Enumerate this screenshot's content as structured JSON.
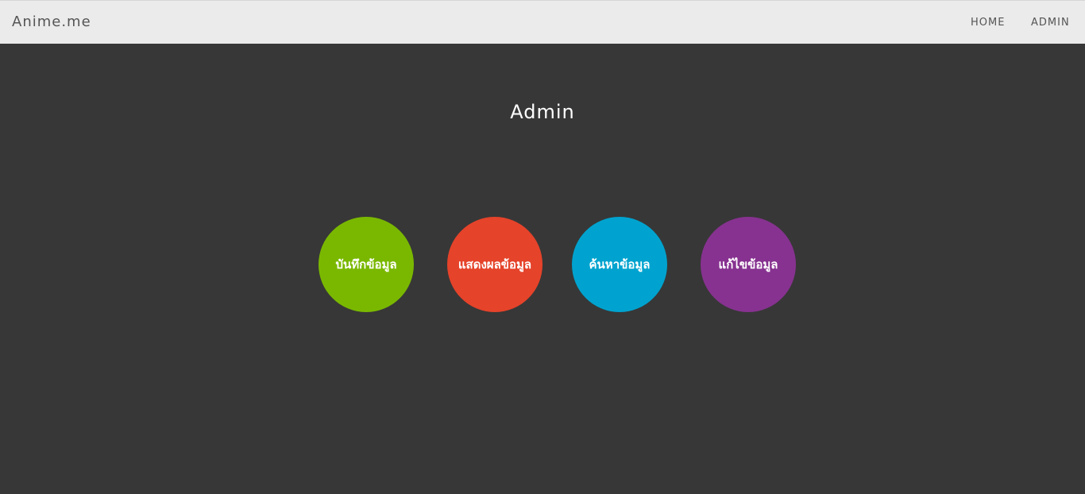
{
  "navbar": {
    "brand": "Anime.me",
    "links": [
      {
        "label": "HOME"
      },
      {
        "label": "ADMIN"
      }
    ]
  },
  "main": {
    "title": "Admin",
    "actions": [
      {
        "label": "บันทึกข้อมูล",
        "color": "#7ab800"
      },
      {
        "label": "แสดงผลข้อมูล",
        "color": "#e5432a"
      },
      {
        "label": "ค้นหาข้อมูล",
        "color": "#00a3cf"
      },
      {
        "label": "แก้ไขข้อมูล",
        "color": "#873290"
      }
    ]
  },
  "colors": {
    "background": "#373737",
    "navbar": "#ebebeb",
    "nav_text": "#555555"
  }
}
